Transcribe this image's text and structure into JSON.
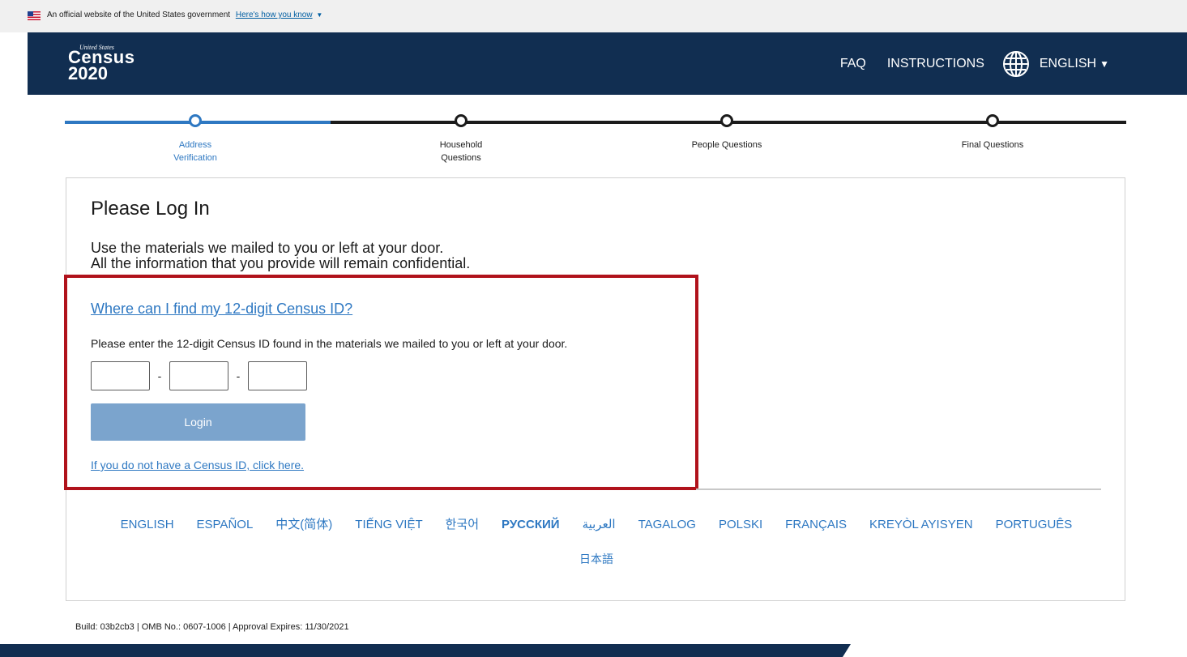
{
  "gov_banner": {
    "text": "An official website of the United States government",
    "link": "Here's how you know"
  },
  "header": {
    "logo": {
      "line1": "United States",
      "line2": "Census",
      "line3": "2020"
    },
    "faq": "FAQ",
    "instructions": "INSTRUCTIONS",
    "language": "ENGLISH"
  },
  "progress": {
    "steps": [
      {
        "label": "Address Verification",
        "active": true
      },
      {
        "label": "Household Questions",
        "active": false
      },
      {
        "label": "People Questions",
        "active": false
      },
      {
        "label": "Final Questions",
        "active": false
      }
    ],
    "active_color": "#2e78c2"
  },
  "login": {
    "title": "Please Log In",
    "intro_line1": "Use the materials we mailed to you or left at your door.",
    "intro_line2": "All the information that you provide will remain confidential.",
    "find_id_link": "Where can I find my 12-digit Census ID?",
    "instructions": "Please enter the 12-digit Census ID found in the materials we mailed to you or left at your door.",
    "id_parts": [
      "",
      "",
      ""
    ],
    "separator": "-",
    "button": "Login",
    "no_id_link": "If you do not have a Census ID, click here."
  },
  "languages": [
    "ENGLISH",
    "ESPAÑOL",
    "中文(简体)",
    "TIẾNG VIỆT",
    "한국어",
    "РУССКИЙ",
    "العربية",
    "TAGALOG",
    "POLSKI",
    "FRANÇAIS",
    "KREYÒL AYISYEN",
    "PORTUGUÊS",
    "日本語"
  ],
  "footer": {
    "build": "Build: 03b2cb3 | OMB No.: 0607-1006 | Approval Expires: 11/30/2021"
  },
  "colors": {
    "header_bg": "#112e51",
    "link": "#2e78c2",
    "highlight_border": "#b0121b",
    "button_bg": "#7ba4cd"
  }
}
